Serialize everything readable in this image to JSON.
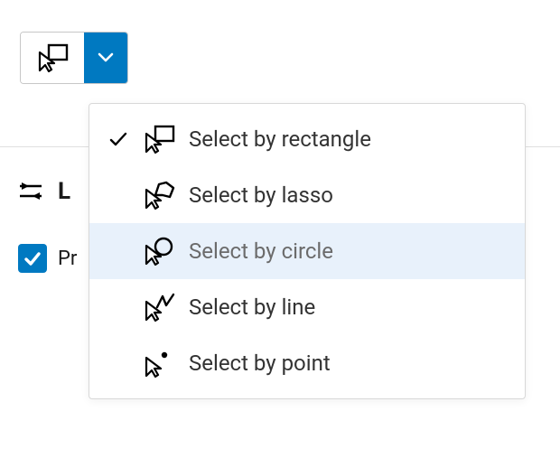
{
  "toolbar": {
    "select_tool_button_name": "select-tool"
  },
  "layers": {
    "heading": "L",
    "items": [
      {
        "label": "Pr",
        "checked": true
      }
    ]
  },
  "select_menu": {
    "items": [
      {
        "label": "Select by rectangle",
        "checked": true,
        "highlighted": false,
        "icon": "cursor-rectangle-icon"
      },
      {
        "label": "Select by lasso",
        "checked": false,
        "highlighted": false,
        "icon": "cursor-lasso-icon"
      },
      {
        "label": "Select by circle",
        "checked": false,
        "highlighted": true,
        "icon": "cursor-circle-icon"
      },
      {
        "label": "Select by line",
        "checked": false,
        "highlighted": false,
        "icon": "cursor-line-icon"
      },
      {
        "label": "Select by point",
        "checked": false,
        "highlighted": false,
        "icon": "cursor-point-icon"
      }
    ]
  },
  "colors": {
    "accent": "#0079c1",
    "highlight_bg": "#e8f1fb"
  }
}
